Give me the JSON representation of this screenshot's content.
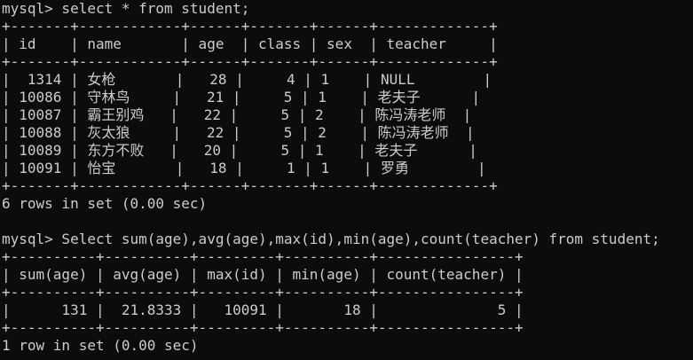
{
  "terminal": {
    "lines": [
      "mysql> select * from student;",
      "+-------+------------+------+-------+------+-------------+",
      "| id    | name       | age  | class | sex  | teacher     |",
      "+-------+------------+------+-------+------+-------------+",
      "|  1314 | 女枪       |   28 |     4 | 1    | NULL        |",
      "| 10086 | 守林鸟     |   21 |     5 | 1    | 老夫子      |",
      "| 10087 | 霸王别鸡   |   22 |     5 | 2    | 陈冯涛老师  |",
      "| 10088 | 灰太狼     |   22 |     5 | 2    | 陈冯涛老师  |",
      "| 10089 | 东方不败   |   20 |     5 | 1    | 老夫子      |",
      "| 10091 | 怡宝       |   18 |     1 | 1    | 罗勇        |",
      "+-------+------------+------+-------+------+-------------+",
      "6 rows in set (0.00 sec)",
      "",
      "mysql> Select sum(age),avg(age),max(id),min(age),count(teacher) from student;",
      "+----------+----------+---------+----------+----------------+",
      "| sum(age) | avg(age) | max(id) | min(age) | count(teacher) |",
      "+----------+----------+---------+----------+----------------+",
      "|      131 |  21.8333 |   10091 |       18 |              5 |",
      "+----------+----------+---------+----------+----------------+",
      "1 row in set (0.00 sec)"
    ]
  }
}
